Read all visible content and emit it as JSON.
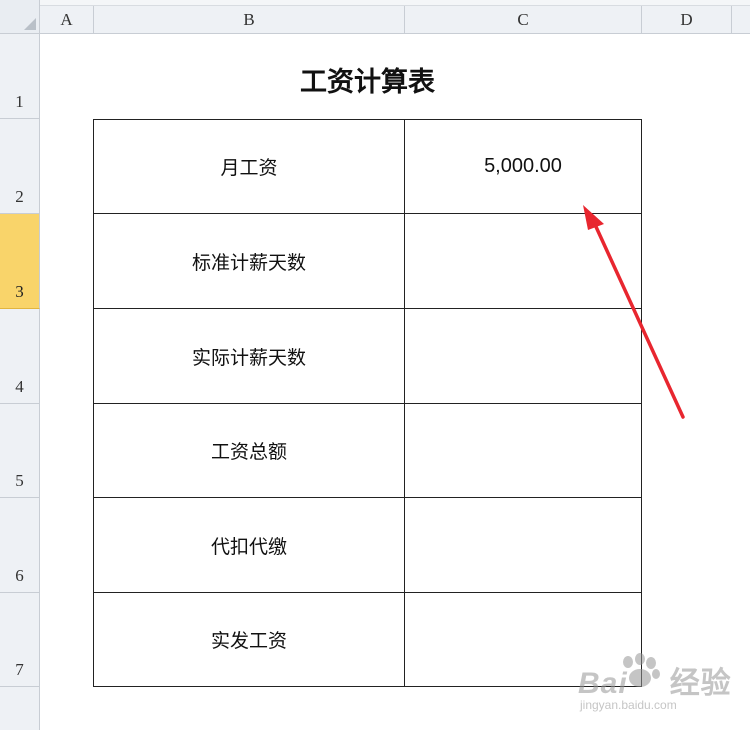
{
  "sheet": {
    "columns": [
      "A",
      "B",
      "C",
      "D"
    ],
    "rows": [
      "1",
      "2",
      "3",
      "4",
      "5",
      "6",
      "7"
    ],
    "selected_row": "3"
  },
  "table": {
    "title": "工资计算表",
    "rows": [
      {
        "label": "月工资",
        "value": "5,000.00"
      },
      {
        "label": "标准计薪天数",
        "value": ""
      },
      {
        "label": "实际计薪天数",
        "value": ""
      },
      {
        "label": "工资总额",
        "value": ""
      },
      {
        "label": "代扣代缴",
        "value": ""
      },
      {
        "label": "实发工资",
        "value": ""
      }
    ]
  },
  "annotation": {
    "arrow_color": "#e8262f"
  },
  "watermark": {
    "logo": "Bai",
    "brand": "经验",
    "url": "jingyan.baidu.com"
  }
}
